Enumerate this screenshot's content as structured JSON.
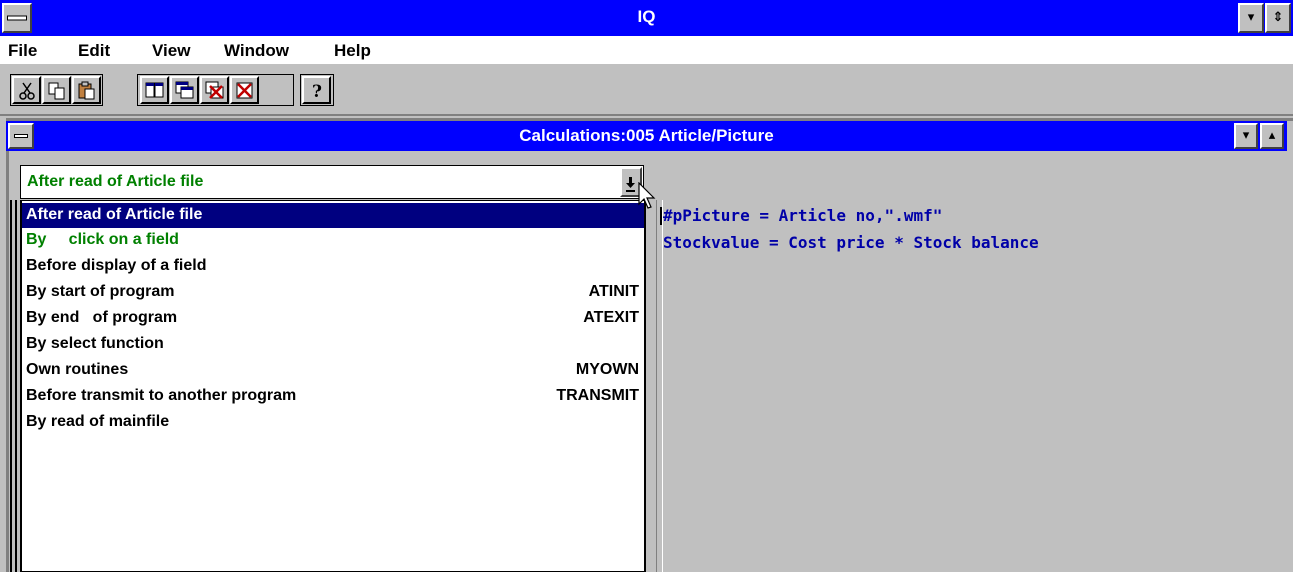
{
  "app": {
    "title": "IQ"
  },
  "menu": {
    "items": [
      "File",
      "Edit",
      "View",
      "Window",
      "Help"
    ]
  },
  "toolbar": {
    "buttons": [
      "cut-icon",
      "copy-icon",
      "paste-icon",
      "tile-icon",
      "cascade-icon",
      "close-all-icon",
      "close-window-icon",
      "help-icon"
    ]
  },
  "window": {
    "title": "Calculations:005  Article/Picture"
  },
  "event_selector": {
    "value": "After read of Article file",
    "options": [
      {
        "label": "After read of Article file",
        "code": ""
      },
      {
        "label": "By     click on a field",
        "code": ""
      },
      {
        "label": "Before display of a field",
        "code": ""
      },
      {
        "label": "By start of program",
        "code": "ATINIT"
      },
      {
        "label": "By end   of program",
        "code": "ATEXIT"
      },
      {
        "label": "By select function",
        "code": ""
      },
      {
        "label": "Own routines",
        "code": "MYOWN"
      },
      {
        "label": "Before transmit to another program",
        "code": "TRANSMIT"
      },
      {
        "label": "By read of mainfile",
        "code": ""
      }
    ]
  },
  "code": {
    "lines": [
      "#pPicture = Article no,\".wmf\"",
      "Stockvalue = Cost price * Stock balance"
    ]
  },
  "colors": {
    "titlebar": "#0000ff",
    "selection": "#000080",
    "code_text": "#0000a8",
    "green_text": "#008000"
  }
}
